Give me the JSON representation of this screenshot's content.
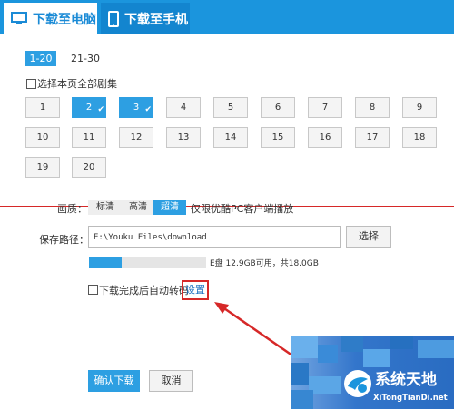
{
  "tabs": [
    {
      "label": "下载至电脑",
      "icon": "monitor-icon",
      "active": true
    },
    {
      "label": "下载至手机",
      "icon": "phone-icon",
      "active": false
    }
  ],
  "pages": [
    "1-20",
    "21-30"
  ],
  "select_all_label": "选择本页全部剧集",
  "episodes": [
    "1",
    "2",
    "3",
    "4",
    "5",
    "6",
    "7",
    "8",
    "9",
    "10",
    "11",
    "12",
    "13",
    "14",
    "15",
    "16",
    "17",
    "18",
    "19",
    "20"
  ],
  "selected_episodes": [
    "2",
    "3"
  ],
  "quality": {
    "label": "画质：",
    "options": [
      "标清",
      "高清",
      "超清"
    ],
    "selected": "超清",
    "note": "仅限优酷PC客户端播放"
  },
  "save_path": {
    "label": "保存路径：",
    "value": "E:\\Youku Files\\download",
    "choose_label": "选择"
  },
  "disk": {
    "text": "E盘 12.9GB可用，共18.0GB",
    "used_fraction": 0.28
  },
  "auto_transcode": {
    "label": "下载完成后自动转码",
    "settings_label": "设置"
  },
  "buttons": {
    "confirm": "确认下载",
    "cancel": "取消"
  },
  "watermark": {
    "title": "系统天地",
    "url": "XiTongTianDi.net"
  },
  "colors": {
    "accent": "#2d9fe2",
    "header": "#1b95dd",
    "highlight": "#d62828"
  }
}
